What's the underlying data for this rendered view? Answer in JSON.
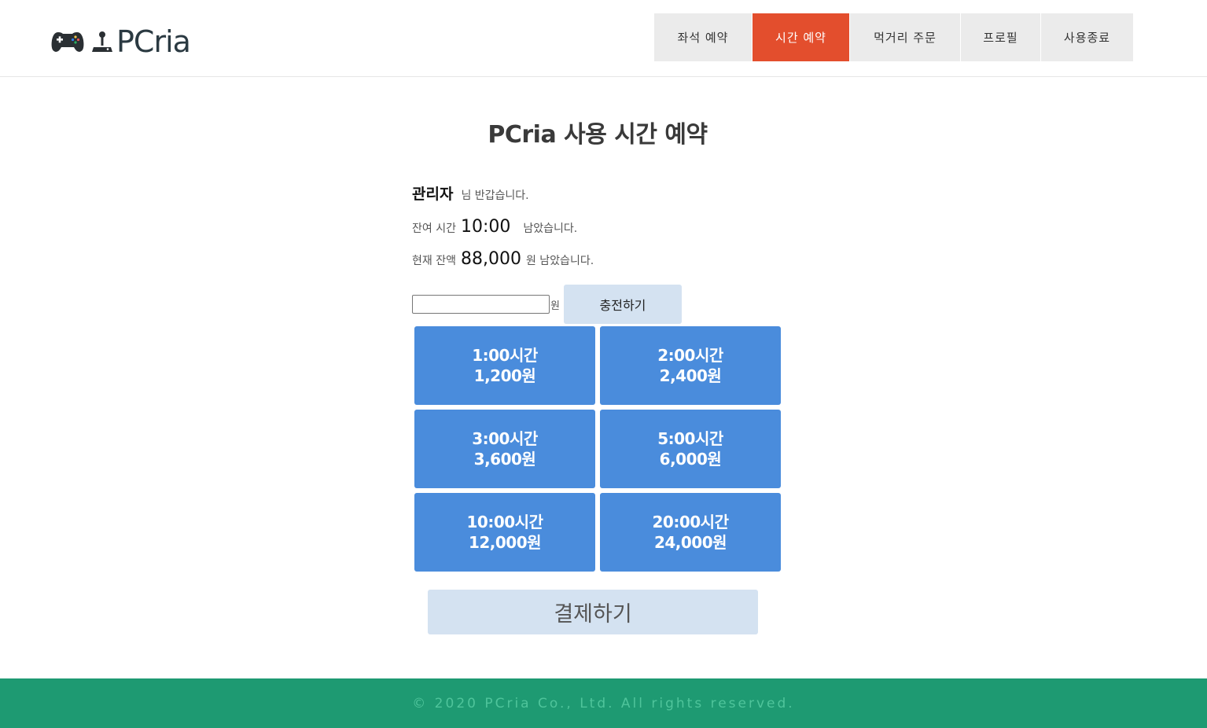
{
  "header": {
    "logo_text": "PCria",
    "nav": [
      {
        "label": "좌석 예약",
        "active": false
      },
      {
        "label": "시간 예약",
        "active": true
      },
      {
        "label": "먹거리 주문",
        "active": false
      },
      {
        "label": "프로필",
        "active": false
      },
      {
        "label": "사용종료",
        "active": false
      }
    ]
  },
  "main": {
    "title": "PCria 사용 시간 예약",
    "greeting": {
      "name": "관리자",
      "suffix": "님 반갑습니다."
    },
    "remaining_time": {
      "prefix": "잔여 시간",
      "value": "10:00",
      "suffix": "남았습니다."
    },
    "balance": {
      "prefix": "현재 잔액",
      "value": "88,000",
      "suffix": "원 남았습니다."
    },
    "charge": {
      "input_value": "",
      "unit": "원",
      "button_label": "충전하기"
    },
    "options": [
      {
        "time": "1:00시간",
        "price": "1,200원"
      },
      {
        "time": "2:00시간",
        "price": "2,400원"
      },
      {
        "time": "3:00시간",
        "price": "3,600원"
      },
      {
        "time": "5:00시간",
        "price": "6,000원"
      },
      {
        "time": "10:00시간",
        "price": "12,000원"
      },
      {
        "time": "20:00시간",
        "price": "24,000원"
      }
    ],
    "pay_button": "결제하기"
  },
  "footer": {
    "text": "© 2020 PCria Co., Ltd. All rights reserved."
  },
  "colors": {
    "nav_active": "#e34e2d",
    "option_blue": "#4a8cdc",
    "light_button": "#d4e2f1",
    "footer_green": "#1e9a72"
  },
  "icons": [
    "game-controller-icon",
    "joystick-icon"
  ]
}
